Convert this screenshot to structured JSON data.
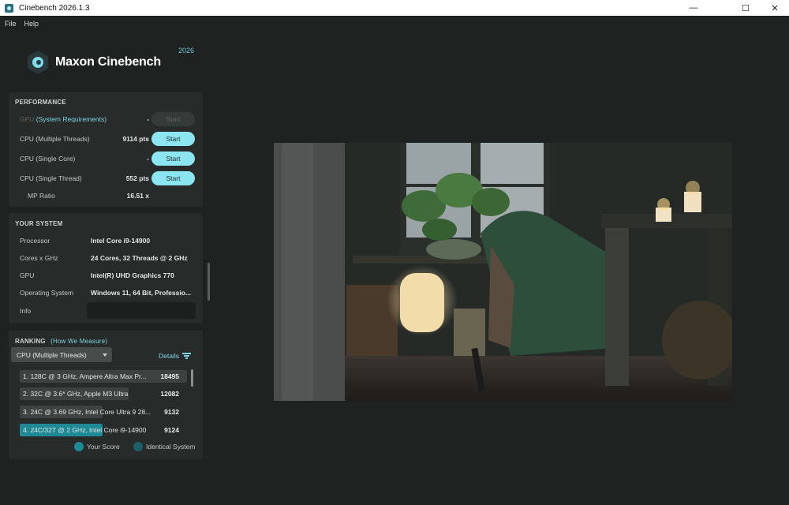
{
  "window": {
    "title": "Cinebench 2026.1.3"
  },
  "menu": {
    "file": "File",
    "help": "Help"
  },
  "logo": {
    "text": "Maxon Cinebench",
    "year": "2026"
  },
  "performance": {
    "title": "PERFORMANCE",
    "gpu": {
      "label": "GPU",
      "link": "(System Requirements)",
      "value": "-",
      "button": "Start"
    },
    "rows": [
      {
        "label": "CPU (Multiple Threads)",
        "value": "9114 pts",
        "button": "Start"
      },
      {
        "label": "CPU (Single Core)",
        "value": "-",
        "button": "Start"
      },
      {
        "label": "CPU (Single Thread)",
        "value": "552 pts",
        "button": "Start"
      }
    ],
    "mp_ratio": {
      "label": "MP Ratio",
      "value": "16.51 x"
    }
  },
  "system": {
    "title": "YOUR SYSTEM",
    "rows": [
      {
        "label": "Processor",
        "value": "Intel Core i9-14900"
      },
      {
        "label": "Cores x GHz",
        "value": "24 Cores, 32 Threads @ 2 GHz"
      },
      {
        "label": "GPU",
        "value": "Intel(R) UHD Graphics 770"
      },
      {
        "label": "Operating System",
        "value": "Windows 11, 64 Bit, Professio..."
      }
    ],
    "info_label": "Info"
  },
  "ranking": {
    "title": "RANKING",
    "link": "(How We Measure)",
    "dropdown": "CPU (Multiple Threads)",
    "details": "Details",
    "rows": [
      {
        "label": "1. 128C @ 3 GHz, Ampere Altra Max Pr...",
        "score": "18495",
        "bar": 1.0
      },
      {
        "label": "2. 32C @ 3.6* GHz, Apple M3 Ultra",
        "score": "12082",
        "bar": 0.653
      },
      {
        "label": "3. 24C @ 3.69 GHz, Intel Core Ultra 9 28...",
        "score": "9132",
        "bar": 0.494
      },
      {
        "label": "4. 24C/32T @ 2 GHz, Intel Core i9-14900",
        "score": "9124",
        "bar": 0.493
      }
    ],
    "legend": {
      "your_score": "Your Score",
      "identical_system": "Identical System"
    }
  },
  "colors": {
    "accent": "#8be6f2",
    "link": "#7ed3e6",
    "your_score": "#1d8a95",
    "identical_system": "#1d5f6a",
    "rank_bar": "#3d4341"
  }
}
